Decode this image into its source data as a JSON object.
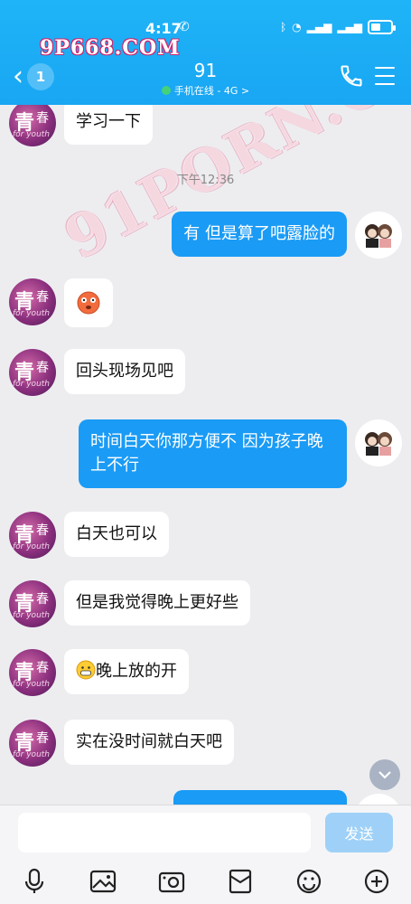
{
  "status_bar": {
    "time": "4:17",
    "network": "4G"
  },
  "header": {
    "watermark": "9P668.COM",
    "unread_count": "1",
    "title": "91",
    "subtitle": "手机在线 - 4G >"
  },
  "chat": {
    "time_divider": "下午12:36",
    "avatar_left": {
      "ch1": "青",
      "ch2": "春",
      "en": "for youth"
    },
    "watermark": "91PORN.COM",
    "messages": [
      {
        "side": "left",
        "text": "学习一下"
      },
      {
        "side": "right",
        "text": "有  但是算了吧露脸的"
      },
      {
        "side": "left",
        "text": "",
        "emoji": "flushed-face"
      },
      {
        "side": "left",
        "text": "回头现场见吧"
      },
      {
        "side": "right",
        "text": "时间白天你那方便不 因为孩子晚上不行"
      },
      {
        "side": "left",
        "text": "白天也可以"
      },
      {
        "side": "left",
        "text": "但是我觉得晚上更好些"
      },
      {
        "side": "left",
        "text": "晚上放的开",
        "emoji": "grin-face"
      },
      {
        "side": "left",
        "text": "实在没时间就白天吧"
      }
    ]
  },
  "input_bar": {
    "placeholder": "",
    "send_label": "发送",
    "tools": [
      "microphone-icon",
      "image-icon",
      "camera-icon",
      "red-packet-icon",
      "emoji-icon",
      "plus-icon"
    ]
  },
  "colors": {
    "header": "#1fb4f7",
    "bubble_right": "#1a9bf5",
    "send_disabled": "#9fd1f8"
  }
}
